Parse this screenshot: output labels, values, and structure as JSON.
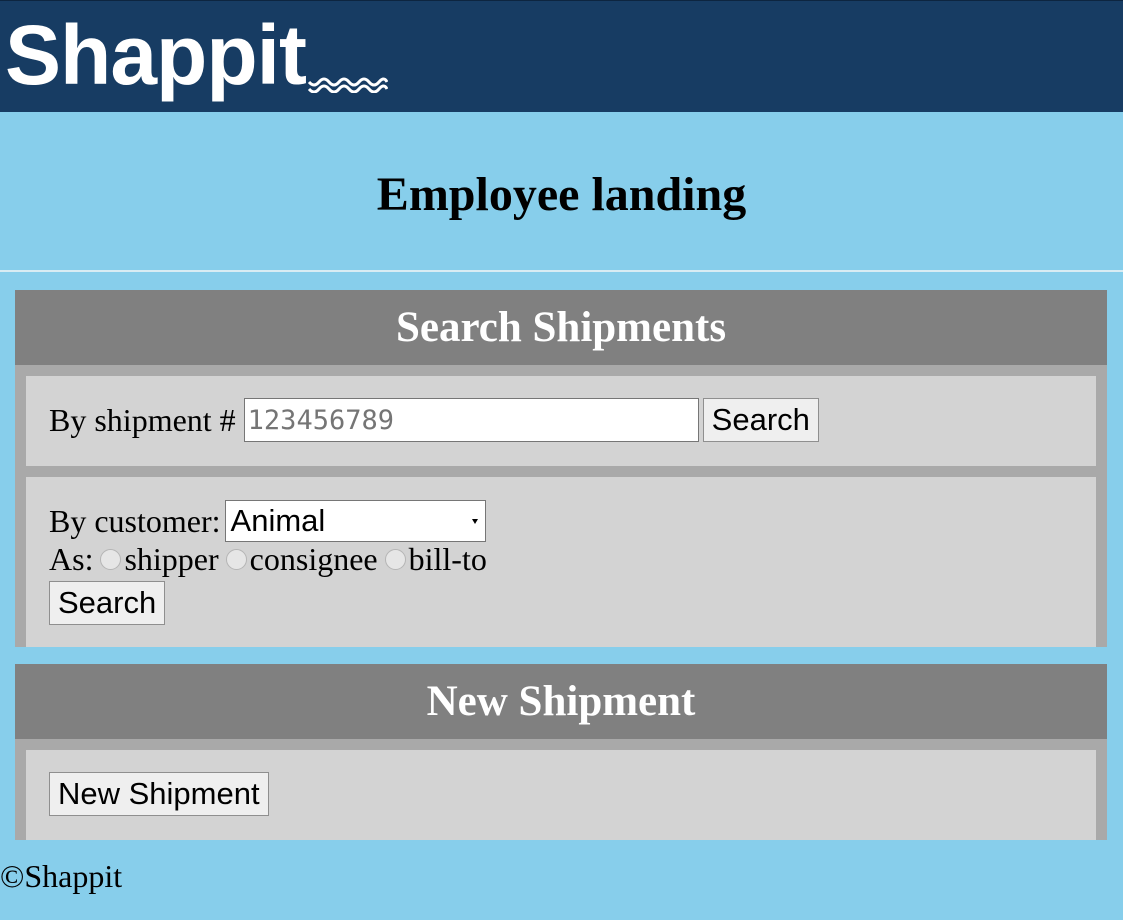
{
  "header": {
    "logo_text": "Shappit"
  },
  "page": {
    "title": "Employee landing"
  },
  "search_panel": {
    "heading": "Search Shipments",
    "by_shipment": {
      "label": "By shipment #",
      "placeholder": "123456789",
      "value": "",
      "button_label": "Search"
    },
    "by_customer": {
      "label": "By customer:",
      "selected_customer": "Animal",
      "as_label": "As:",
      "roles": [
        {
          "label": "shipper",
          "checked": false
        },
        {
          "label": "consignee",
          "checked": false
        },
        {
          "label": "bill-to",
          "checked": false
        }
      ],
      "button_label": "Search"
    }
  },
  "new_panel": {
    "heading": "New Shipment",
    "button_label": "New Shipment"
  },
  "footer": {
    "copyright": "©Shappit"
  },
  "colors": {
    "header_bg": "#173c63",
    "page_bg": "#87ceeb",
    "panel_header_bg": "#808080",
    "panel_body_bg": "#d3d3d3"
  }
}
